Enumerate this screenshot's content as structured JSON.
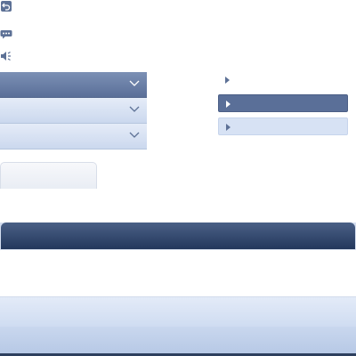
{
  "toolbar": {
    "icons": [
      "undo-icon",
      "chat-icon",
      "volume-icon"
    ]
  },
  "accordion": {
    "items": [
      {
        "label": "",
        "state": "active"
      },
      {
        "label": "",
        "state": "normal"
      },
      {
        "label": "",
        "state": "normal"
      }
    ]
  },
  "tree": {
    "items": [
      {
        "label": "",
        "state": "normal"
      },
      {
        "label": "",
        "state": "selected"
      },
      {
        "label": "",
        "state": "hover"
      }
    ]
  },
  "tabs": {
    "light_tab_label": "",
    "dark_tab_label": ""
  },
  "colors": {
    "accent": "#5a6f98",
    "dark_header": "#23385c",
    "light_band": "#d7e2f4"
  }
}
